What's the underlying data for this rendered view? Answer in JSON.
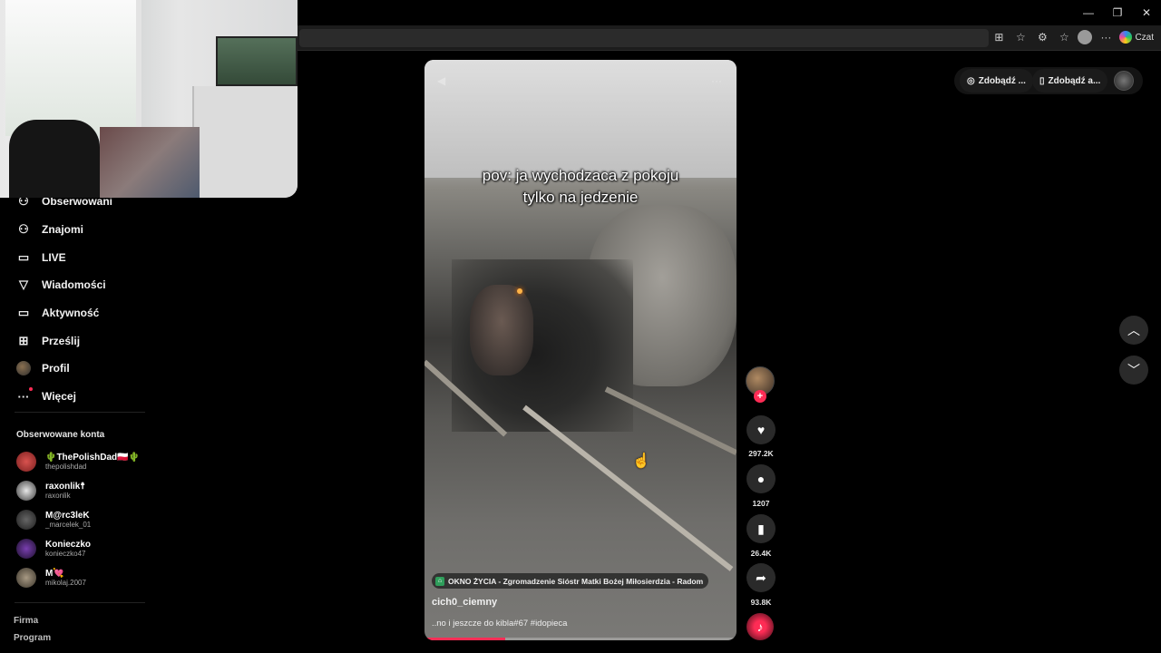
{
  "browser": {
    "window_controls": {
      "minimize": "—",
      "restore": "❐",
      "close": "✕"
    },
    "copilot_label": "Czat"
  },
  "sidebar": {
    "nav": [
      {
        "label": "Obserwowani",
        "icon": "following-icon",
        "glyph": "⚇"
      },
      {
        "label": "Znajomi",
        "icon": "friends-icon",
        "glyph": "⚇"
      },
      {
        "label": "LIVE",
        "icon": "live-icon",
        "glyph": "▭"
      },
      {
        "label": "Wiadomości",
        "icon": "messages-icon",
        "glyph": "▽"
      },
      {
        "label": "Aktywność",
        "icon": "activity-icon",
        "glyph": "▭"
      },
      {
        "label": "Prześlij",
        "icon": "upload-icon",
        "glyph": "⊞"
      },
      {
        "label": "Profil",
        "icon": "profile-icon",
        "glyph": ""
      },
      {
        "label": "Więcej",
        "icon": "more-icon",
        "glyph": "···"
      }
    ],
    "followed_title": "Obserwowane konta",
    "accounts": [
      {
        "name": "🌵ThePolishDad🇵🇱🌵",
        "handle": "thepolishdad"
      },
      {
        "name": "raxonlik☨",
        "handle": "raxonlik"
      },
      {
        "name": "M@rc3leK",
        "handle": "_marcelek_01"
      },
      {
        "name": "Konieczko",
        "handle": "konieczko47"
      },
      {
        "name": "M💘",
        "handle": "mikolaj.2007"
      }
    ],
    "footer": [
      "Firma",
      "Program"
    ]
  },
  "video": {
    "overlay_text_line1": "pov: ja wychodzaca z pokoju",
    "overlay_text_line2": "tylko na jedzenie",
    "location": "OKNO ŻYCIA - Zgromadzenie Sióstr Matki Bożej Miłosierdzia - Radom",
    "author": "cich0_ciemny",
    "caption": "..no i jeszcze do kibla#67 #idopieca",
    "progress": 0.26
  },
  "actions": {
    "likes": "297.2K",
    "comments": "1207",
    "saves": "26.4K",
    "shares": "93.8K"
  },
  "top_right": {
    "pill1": "Zdobądź ...",
    "pill2": "Zdobądź a..."
  },
  "colors": {
    "accent": "#fe2c55",
    "background": "#000000"
  }
}
